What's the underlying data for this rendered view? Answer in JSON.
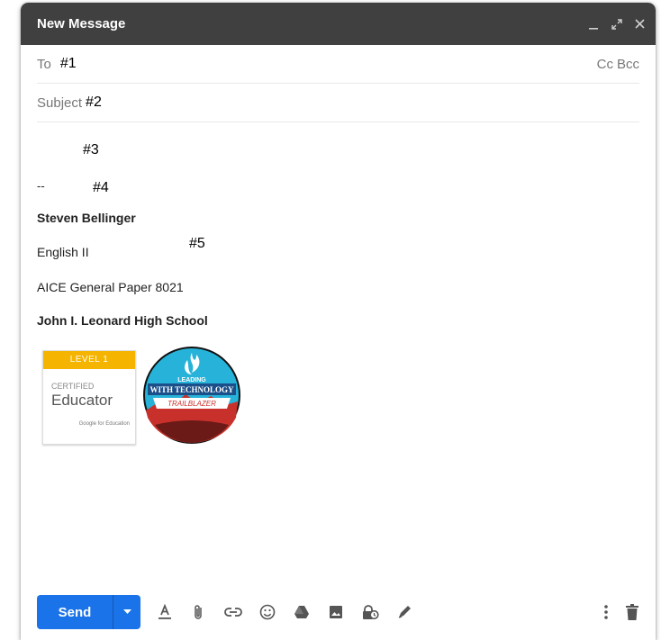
{
  "window": {
    "title": "New Message"
  },
  "to": {
    "label": "To",
    "value": "#1",
    "cc_label": "Cc",
    "bcc_label": "Bcc"
  },
  "subject": {
    "label": "Subject",
    "value": "#2"
  },
  "body": {
    "markers": {
      "m3": "#3",
      "m4": "#4",
      "m5": "#5"
    },
    "separator": "--",
    "signature": {
      "name": "Steven Bellinger",
      "line1": "English II",
      "line2": "AICE General Paper 8021",
      "school": "John I. Leonard High School"
    },
    "badge_certified": {
      "level": "LEVEL 1",
      "certified": "CERTIFIED",
      "role": "Educator",
      "issuer": "Google for Education"
    },
    "badge_trailblazer": {
      "line1": "LEADING",
      "line2": "WITH TECHNOLOGY",
      "line3": "TRAILBLAZER"
    }
  },
  "toolbar": {
    "send_label": "Send"
  },
  "colors": {
    "titlebar": "#404040",
    "send": "#1a73e8",
    "badge_gold": "#f4b400"
  }
}
